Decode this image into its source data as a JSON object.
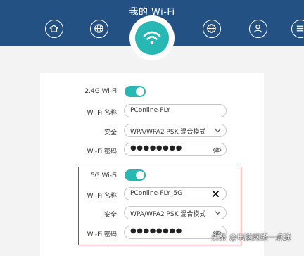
{
  "header": {
    "title": "我的 Wi-Fi",
    "bg_color": "#245184",
    "accent": "#27b8b3"
  },
  "nav_icons": [
    "home-icon",
    "globe-icon",
    "wifi-icon",
    "globe-icon",
    "user-icon",
    "menu-icon"
  ],
  "wifi24": {
    "toggle_label": "2.4G Wi-Fi",
    "toggle_on": true,
    "name_label": "Wi-Fi 名称",
    "name_value": "PConline-FLY",
    "security_label": "安全",
    "security_value": "WPA/WPA2 PSK 混合模式",
    "password_label": "Wi-Fi 密码",
    "password_value": "●●●●●●●●"
  },
  "wifi5g": {
    "toggle_label": "5G Wi-Fi",
    "toggle_on": true,
    "name_label": "Wi-Fi 名称",
    "name_value": "PConline-FLY_5G",
    "security_label": "安全",
    "security_value": "WPA/WPA2 PSK 混合模式",
    "password_label": "Wi-Fi 密码",
    "password_value": "●●●●●●●●"
  },
  "watermark": "头条 @电脑网络一点通",
  "highlight_color": "#d3302f"
}
